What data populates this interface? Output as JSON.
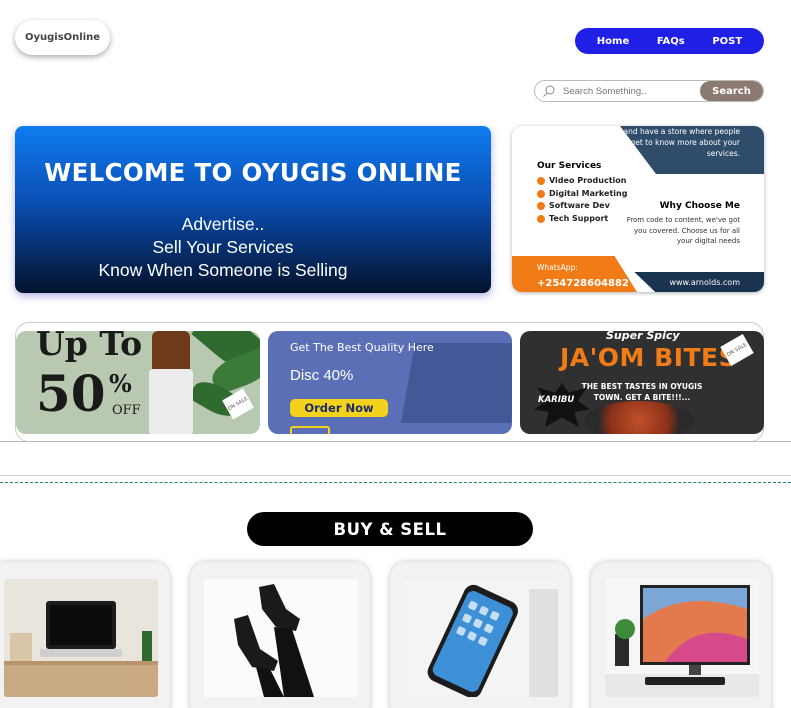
{
  "header": {
    "logo_text": "OyugisOnline",
    "nav": [
      "Home",
      "FAQs",
      "POST"
    ]
  },
  "search": {
    "placeholder": "Search Something..",
    "button_label": "Search"
  },
  "hero": {
    "title": "WELCOME TO OYUGIS ONLINE",
    "line1": "Advertise..",
    "line2": "Sell Your Services",
    "line3": "Know When Someone is Selling"
  },
  "services_ad": {
    "top_text": "and have a store where people get to know more about your services.",
    "our_services_title": "Our Services",
    "services": [
      "Video Production",
      "Digital Marketing",
      "Software Dev",
      "Tech Support"
    ],
    "why_title": "Why Choose Me",
    "why_text": "From code to content, we've got you covered. Choose us for all your digital needs",
    "whatsapp_label": "WhatsApp:",
    "phone": "+254728604882",
    "website": "www.arnolds.com"
  },
  "promos": {
    "p1": {
      "line1": "Up To",
      "line2": "50",
      "pct": "%",
      "off": "OFF",
      "tag": "ON SALE"
    },
    "p2": {
      "headline": "Get The Best Quality Here",
      "discount": "Disc 40%",
      "button": "Order Now"
    },
    "p3": {
      "spicy": "Super Spicy",
      "brand": "JA'OM BITES",
      "taste": "THE BEST TASTES IN OYUGIS TOWN. GET A BITE!!!...",
      "karibu": "KARIBU",
      "tag": "ON SALE"
    }
  },
  "buy_sell": {
    "title": "BUY & SELL"
  },
  "colors": {
    "nav_bg": "#1f1fe6",
    "search_button": "#8a7a72",
    "accent_orange": "#f07b17",
    "navy": "#1a3350"
  }
}
